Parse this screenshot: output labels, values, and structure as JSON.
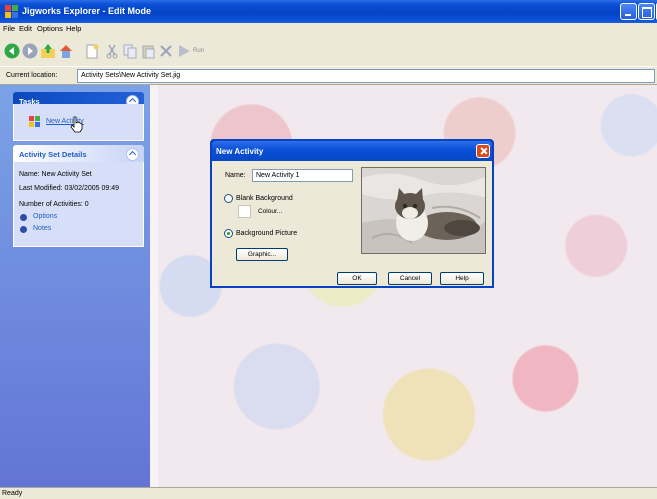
{
  "window": {
    "title": "Jigworks Explorer - Edit Mode"
  },
  "menu": {
    "items": [
      "File",
      "Edit",
      "Options",
      "Help"
    ]
  },
  "toolbar": {
    "run_label": "Run",
    "icons": [
      "back-icon",
      "forward-icon",
      "up-folder-icon",
      "home-icon",
      "new-icon",
      "cut-icon",
      "copy-icon",
      "paste-icon",
      "delete-icon",
      "run-icon"
    ]
  },
  "address": {
    "label": "Current location:",
    "value": "Activity Sets\\New Activity Set.jig"
  },
  "tasks": {
    "header": "Tasks",
    "new_activity": "New Activity"
  },
  "details": {
    "header": "Activity Set Details",
    "name": "Name: New Activity Set",
    "modified": "Last Modified: 03/02/2005 09:49",
    "count": "Number of Activities: 0",
    "options": "Options",
    "notes": "Notes"
  },
  "dialog": {
    "title": "New Activity",
    "name_label": "Name:",
    "name_value": "New Activity 1",
    "blank_background": "Blank Background",
    "colour": "Colour...",
    "background_picture": "Background Picture",
    "graphic": "Graphic...",
    "ok": "OK",
    "cancel": "Cancel",
    "help": "Help",
    "selected_background": "Background Picture"
  },
  "status": {
    "text": "Ready"
  },
  "colors": {
    "title_blue": "#0544c4",
    "taskpane_blue": "#6f8ddf",
    "link_blue": "#215dc6"
  }
}
